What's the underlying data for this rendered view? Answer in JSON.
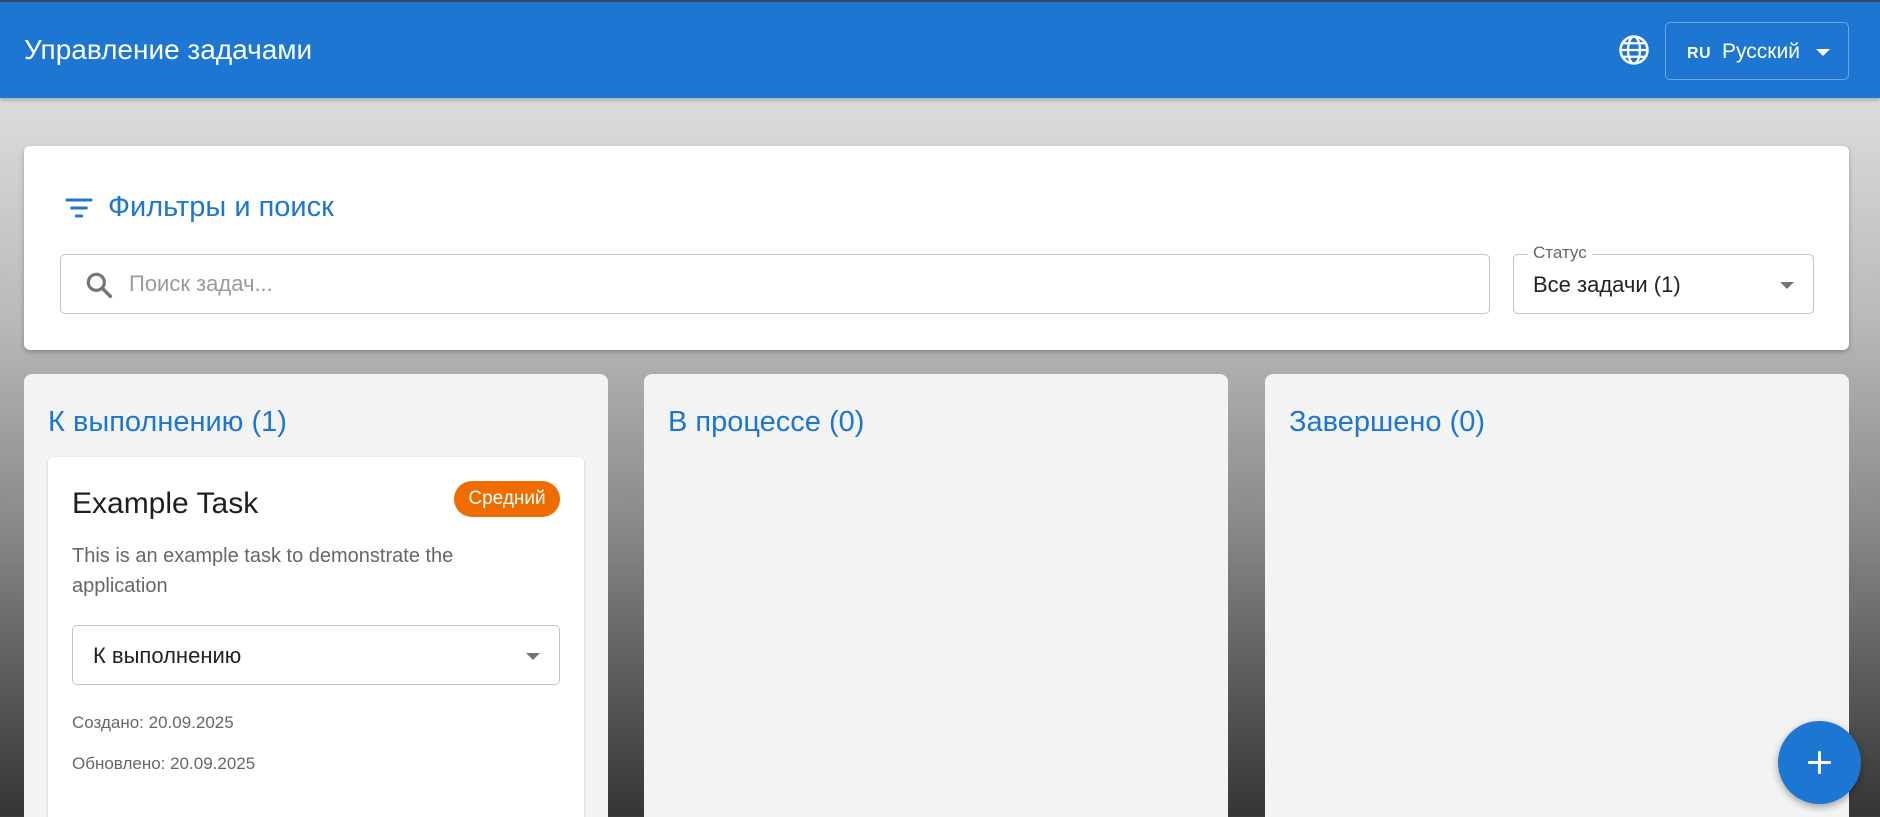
{
  "colors": {
    "primary": "#1c76d2",
    "priority_medium": "#ef6c00"
  },
  "header": {
    "title": "Управление задачами",
    "language_icon": "globe-icon",
    "language": {
      "code": "RU",
      "label": "Русский"
    }
  },
  "filters": {
    "icon": "filter-icon",
    "title": "Фильтры и поиск",
    "search": {
      "icon": "search-icon",
      "placeholder": "Поиск задач...",
      "value": ""
    },
    "status": {
      "label": "Статус",
      "value": "Все задачи (1)"
    }
  },
  "columns": [
    {
      "title": "К выполнению (1)",
      "tasks": [
        {
          "title": "Example Task",
          "priority": "Средний",
          "description": "This is an example task to demonstrate the application",
          "status": "К выполнению",
          "created": "Создано: 20.09.2025",
          "updated": "Обновлено: 20.09.2025"
        }
      ]
    },
    {
      "title": "В процессе (0)",
      "tasks": []
    },
    {
      "title": "Завершено (0)",
      "tasks": []
    }
  ],
  "fab": {
    "icon": "plus-icon"
  }
}
